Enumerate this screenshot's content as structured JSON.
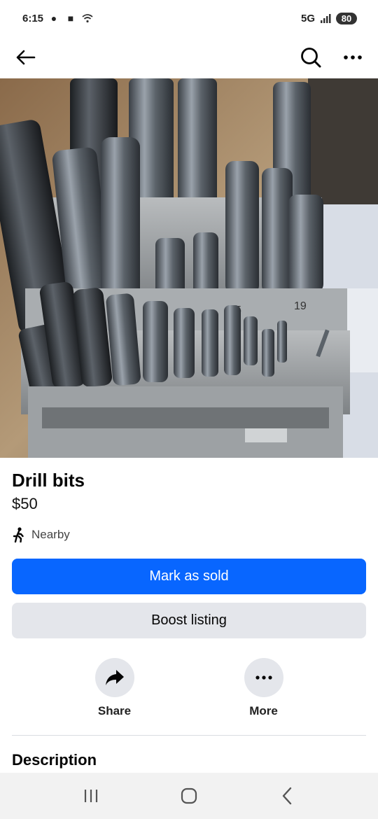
{
  "status_bar": {
    "time": "6:15",
    "network": "5G",
    "battery": "80"
  },
  "header": {
    "back_icon": "arrow-left-icon",
    "search_icon": "search-icon",
    "more_icon": "more-horizontal-icon"
  },
  "listing": {
    "photo_subject": "drill bit index case",
    "title": "Drill bits",
    "price": "$50",
    "location": "Nearby",
    "location_icon": "walking-person-icon"
  },
  "buttons": {
    "primary": "Mark as sold",
    "secondary": "Boost listing"
  },
  "actions": [
    {
      "label": "Share",
      "icon": "share-arrow-icon"
    },
    {
      "label": "More",
      "icon": "more-dots-icon"
    }
  ],
  "description": {
    "heading": "Description"
  },
  "colors": {
    "accent": "#0866ff",
    "secondary_button": "#e4e6eb",
    "text": "#050505"
  }
}
